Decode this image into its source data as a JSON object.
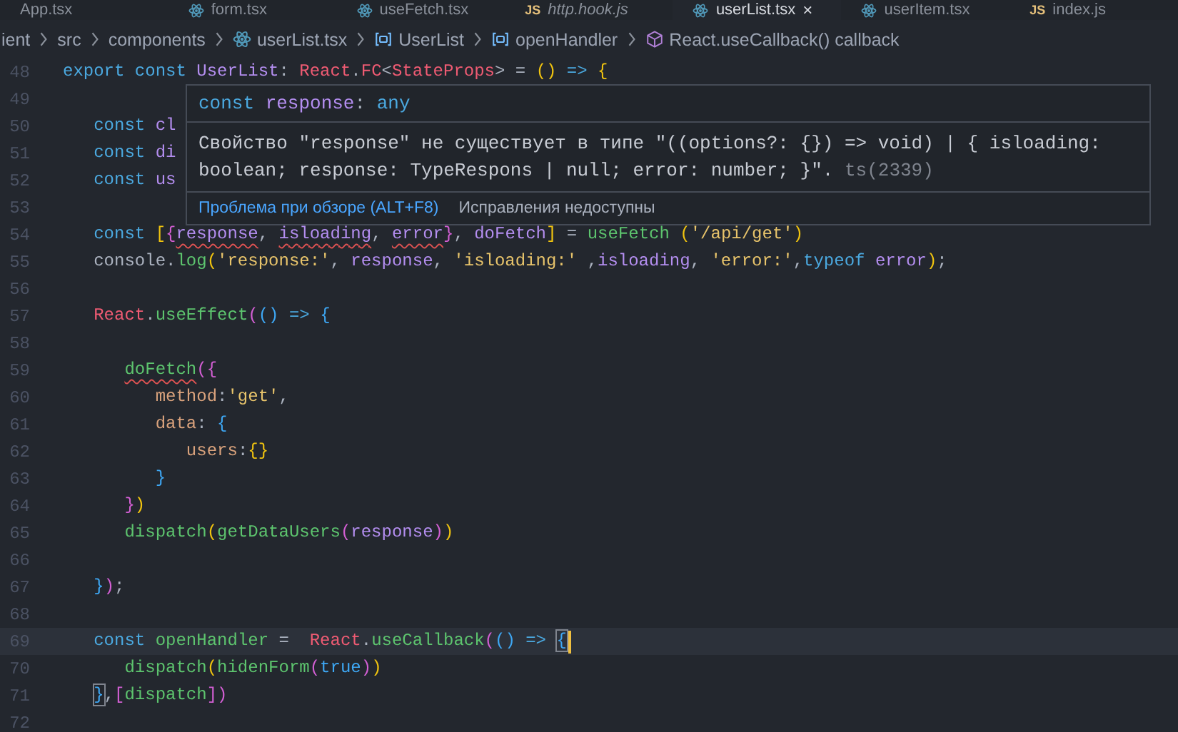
{
  "tabs": [
    {
      "label": "App.tsx",
      "kind": "plain",
      "selected": false,
      "preview": false
    },
    {
      "label": "form.tsx",
      "kind": "react",
      "selected": false,
      "preview": false
    },
    {
      "label": "useFetch.tsx",
      "kind": "react",
      "selected": false,
      "preview": false
    },
    {
      "label": "http.hook.js",
      "kind": "js",
      "icon_label": "JS",
      "selected": false,
      "preview": true
    },
    {
      "label": "userList.tsx",
      "kind": "react",
      "selected": true,
      "preview": false,
      "close": "×"
    },
    {
      "label": "userItem.tsx",
      "kind": "react",
      "selected": false,
      "preview": false
    },
    {
      "label": "index.js",
      "kind": "js",
      "icon_label": "JS",
      "selected": false,
      "preview": false
    }
  ],
  "breadcrumbs": [
    {
      "label": "ient",
      "kind": "folder"
    },
    {
      "label": "src",
      "kind": "folder"
    },
    {
      "label": "components",
      "kind": "folder"
    },
    {
      "label": "userList.tsx",
      "kind": "react"
    },
    {
      "label": "UserList",
      "kind": "variable"
    },
    {
      "label": "openHandler",
      "kind": "variable"
    },
    {
      "label": "React.useCallback() callback",
      "kind": "method"
    }
  ],
  "lines": [
    {
      "number": "48",
      "current": false,
      "tokens": [
        {
          "text": "export ",
          "kind": "kw"
        },
        {
          "text": "const ",
          "kind": "kw"
        },
        {
          "text": "UserList",
          "kind": "var"
        },
        {
          "text": ": ",
          "kind": "punct"
        },
        {
          "text": "React",
          "kind": "cls"
        },
        {
          "text": ".",
          "kind": "punct"
        },
        {
          "text": "FC",
          "kind": "cls"
        },
        {
          "text": "<",
          "kind": "punct"
        },
        {
          "text": "StateProps",
          "kind": "cls"
        },
        {
          "text": ">",
          "kind": "punct"
        },
        {
          "text": " = ",
          "kind": "punct"
        },
        {
          "text": "()",
          "kind": "b1"
        },
        {
          "text": " => ",
          "kind": "kw"
        },
        {
          "text": "{",
          "kind": "b1"
        }
      ]
    },
    {
      "number": "49",
      "current": false
    },
    {
      "number": "50",
      "current": false,
      "tokens": [
        {
          "text": "   const ",
          "kind": "kw"
        },
        {
          "text": "cl",
          "kind": "var"
        }
      ]
    },
    {
      "number": "51",
      "current": false,
      "tokens": [
        {
          "text": "   const ",
          "kind": "kw"
        },
        {
          "text": "di",
          "kind": "var"
        }
      ]
    },
    {
      "number": "52",
      "current": false,
      "tokens": [
        {
          "text": "   const ",
          "kind": "kw"
        },
        {
          "text": "us",
          "kind": "var"
        }
      ]
    },
    {
      "number": "53",
      "current": false
    },
    {
      "number": "54",
      "current": false,
      "tokens": [
        {
          "text": "   const ",
          "kind": "kw"
        },
        {
          "text": "[",
          "kind": "b1"
        },
        {
          "text": "{",
          "kind": "b2"
        },
        {
          "text": "response",
          "kind": "var",
          "error": true
        },
        {
          "text": ", ",
          "kind": "punct"
        },
        {
          "text": "isloading",
          "kind": "var",
          "error": true
        },
        {
          "text": ", ",
          "kind": "punct"
        },
        {
          "text": "error",
          "kind": "var",
          "error": true
        },
        {
          "text": "}",
          "kind": "b2"
        },
        {
          "text": ", ",
          "kind": "punct"
        },
        {
          "text": "doFetch",
          "kind": "var"
        },
        {
          "text": "]",
          "kind": "b1"
        },
        {
          "text": " = ",
          "kind": "punct"
        },
        {
          "text": "useFetch",
          "kind": "fn"
        },
        {
          "text": " (",
          "kind": "b1"
        },
        {
          "text": "'/api/get'",
          "kind": "str"
        },
        {
          "text": ")",
          "kind": "b1"
        }
      ]
    },
    {
      "number": "55",
      "current": false,
      "tokens": [
        {
          "text": "   console.",
          "kind": "punct"
        },
        {
          "text": "log",
          "kind": "fn"
        },
        {
          "text": "(",
          "kind": "b1"
        },
        {
          "text": "'response:'",
          "kind": "str"
        },
        {
          "text": ", ",
          "kind": "punct"
        },
        {
          "text": "response",
          "kind": "var"
        },
        {
          "text": ", ",
          "kind": "punct"
        },
        {
          "text": "'isloading:'",
          "kind": "str"
        },
        {
          "text": " ,",
          "kind": "punct"
        },
        {
          "text": "isloading",
          "kind": "var"
        },
        {
          "text": ", ",
          "kind": "punct"
        },
        {
          "text": "'error:'",
          "kind": "str"
        },
        {
          "text": ",",
          "kind": "punct"
        },
        {
          "text": "typeof ",
          "kind": "kw"
        },
        {
          "text": "error",
          "kind": "var"
        },
        {
          "text": ")",
          "kind": "b1"
        },
        {
          "text": ";",
          "kind": "punct"
        }
      ]
    },
    {
      "number": "56",
      "current": false
    },
    {
      "number": "57",
      "current": false,
      "tokens": [
        {
          "text": "   React",
          "kind": "cls"
        },
        {
          "text": ".",
          "kind": "punct"
        },
        {
          "text": "useEffect",
          "kind": "fn"
        },
        {
          "text": "(",
          "kind": "b2"
        },
        {
          "text": "()",
          "kind": "b3"
        },
        {
          "text": " => ",
          "kind": "kw"
        },
        {
          "text": "{",
          "kind": "b3"
        }
      ]
    },
    {
      "number": "58",
      "current": false
    },
    {
      "number": "59",
      "current": false,
      "tokens": [
        {
          "text": "      doFetch",
          "kind": "fn",
          "error": true
        },
        {
          "text": "({",
          "kind": "b2"
        }
      ]
    },
    {
      "number": "60",
      "current": false,
      "tokens": [
        {
          "text": "         method",
          "kind": "prop"
        },
        {
          "text": ":",
          "kind": "punct"
        },
        {
          "text": "'get'",
          "kind": "str"
        },
        {
          "text": ",",
          "kind": "punct"
        }
      ]
    },
    {
      "number": "61",
      "current": false,
      "tokens": [
        {
          "text": "         data",
          "kind": "prop"
        },
        {
          "text": ": ",
          "kind": "punct"
        },
        {
          "text": "{",
          "kind": "b3"
        }
      ]
    },
    {
      "number": "62",
      "current": false,
      "tokens": [
        {
          "text": "            users",
          "kind": "prop"
        },
        {
          "text": ":",
          "kind": "punct"
        },
        {
          "text": "{}",
          "kind": "b1"
        }
      ]
    },
    {
      "number": "63",
      "current": false,
      "tokens": [
        {
          "text": "         }",
          "kind": "b3"
        }
      ]
    },
    {
      "number": "64",
      "current": false,
      "tokens": [
        {
          "text": "      }",
          "kind": "b2"
        },
        {
          "text": ")",
          "kind": "b1"
        }
      ]
    },
    {
      "number": "65",
      "current": false,
      "tokens": [
        {
          "text": "      dispatch",
          "kind": "fn"
        },
        {
          "text": "(",
          "kind": "b1"
        },
        {
          "text": "getDataUsers",
          "kind": "fn"
        },
        {
          "text": "(",
          "kind": "b2"
        },
        {
          "text": "response",
          "kind": "var"
        },
        {
          "text": ")",
          "kind": "b2"
        },
        {
          "text": ")",
          "kind": "b1"
        }
      ]
    },
    {
      "number": "66",
      "current": false
    },
    {
      "number": "67",
      "current": false,
      "tokens": [
        {
          "text": "   }",
          "kind": "b3"
        },
        {
          "text": ")",
          "kind": "b2"
        },
        {
          "text": ";",
          "kind": "punct"
        }
      ]
    },
    {
      "number": "68",
      "current": false
    },
    {
      "number": "69",
      "current": true,
      "tokens": [
        {
          "text": "   const ",
          "kind": "kw"
        },
        {
          "text": "openHandler",
          "kind": "fn"
        },
        {
          "text": " =  ",
          "kind": "punct"
        },
        {
          "text": "React",
          "kind": "cls"
        },
        {
          "text": ".",
          "kind": "punct"
        },
        {
          "text": "useCallback",
          "kind": "fn"
        },
        {
          "text": "(",
          "kind": "b2"
        },
        {
          "text": "()",
          "kind": "b3"
        },
        {
          "text": " => ",
          "kind": "kw"
        },
        {
          "text": "{",
          "kind": "b3",
          "match": true
        }
      ]
    },
    {
      "number": "70",
      "current": false,
      "tokens": [
        {
          "text": "      dispatch",
          "kind": "fn"
        },
        {
          "text": "(",
          "kind": "b1"
        },
        {
          "text": "hidenForm",
          "kind": "fn"
        },
        {
          "text": "(",
          "kind": "b2"
        },
        {
          "text": "true",
          "kind": "bool"
        },
        {
          "text": ")",
          "kind": "b2"
        },
        {
          "text": ")",
          "kind": "b1"
        }
      ]
    },
    {
      "number": "71",
      "current": false,
      "tokens": [
        {
          "text": "   }",
          "kind": "b3",
          "match": true
        },
        {
          "text": ",",
          "kind": "punct"
        },
        {
          "text": "[",
          "kind": "b2"
        },
        {
          "text": "dispatch",
          "kind": "fn"
        },
        {
          "text": "]",
          "kind": "b2"
        },
        {
          "text": ")",
          "kind": "b2"
        }
      ]
    },
    {
      "number": "72",
      "current": false
    }
  ],
  "hover": {
    "signature": [
      {
        "text": "const ",
        "kind": "kw"
      },
      {
        "text": "response",
        "kind": "var"
      },
      {
        "text": ": ",
        "kind": "punct"
      },
      {
        "text": "any",
        "kind": "kw"
      }
    ],
    "message": "Свойство \"response\" не существует в типе \"((options?: {}) => void) | { isloading: boolean; response: TypeRespons | null; error: number; }\".",
    "code": "ts(2339)",
    "link": "Проблема при обзоре (ALT+F8)",
    "note": "Исправления недоступны"
  }
}
